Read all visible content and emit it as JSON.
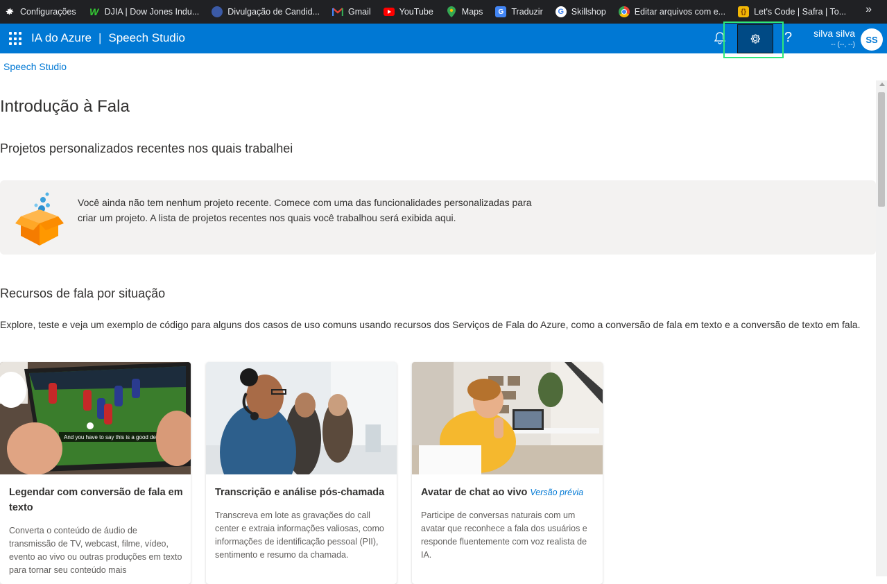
{
  "bookmarks": [
    {
      "label": "Configurações",
      "icon": "gear-icon",
      "color": "#5f6368"
    },
    {
      "label": "DJIA | Dow Jones Indu...",
      "icon": "wsj-icon",
      "color": "#1a8a1a"
    },
    {
      "label": "Divulgação de Candid...",
      "icon": "globe-icon",
      "color": "#3b5aa6"
    },
    {
      "label": "Gmail",
      "icon": "gmail-icon",
      "color": "#ea4335"
    },
    {
      "label": "YouTube",
      "icon": "youtube-icon",
      "color": "#ff0000"
    },
    {
      "label": "Maps",
      "icon": "maps-icon",
      "color": "#34a853"
    },
    {
      "label": "Traduzir",
      "icon": "translate-icon",
      "color": "#4285f4"
    },
    {
      "label": "Skillshop",
      "icon": "google-icon",
      "color": "#ffffff"
    },
    {
      "label": "Editar arquivos com e...",
      "icon": "chrome-icon",
      "color": "#fbbc05"
    },
    {
      "label": "Let's Code | Safra | To...",
      "icon": "letscode-icon",
      "color": "#f2b705"
    }
  ],
  "header": {
    "product": "IA do Azure",
    "separator": "|",
    "app": "Speech Studio",
    "user_name": "silva silva",
    "user_sub": "-- (--, --)",
    "avatar_initials": "SS",
    "help_label": "?"
  },
  "breadcrumb": "Speech Studio",
  "page_title": "Introdução à Fala",
  "recent": {
    "heading": "Projetos personalizados recentes nos quais trabalhei",
    "empty_message": "Você ainda não tem nenhum projeto recente. Comece com uma das funcionalidades personalizadas para criar um projeto. A lista de projetos recentes nos quais você trabalhou será exibida aqui."
  },
  "resources": {
    "heading": "Recursos de fala por situação",
    "description": "Explore, teste e veja um exemplo de código para alguns dos casos de uso comuns usando recursos dos Serviços de Fala do Azure, como a conversão de fala em texto e a conversão de texto em fala."
  },
  "cards": [
    {
      "title": "Legendar com conversão de fala em texto",
      "badge": "",
      "caption": "And you have to say this is a good defense.",
      "description": "Converta o conteúdo de áudio de transmissão de TV, webcast, filme, vídeo, evento ao vivo ou outras produções em texto para tornar seu conteúdo mais"
    },
    {
      "title": "Transcrição e análise pós-chamada",
      "badge": "",
      "description": "Transcreva em lote as gravações do call center e extraia informações valiosas, como informações de identificação pessoal (PII), sentimento e resumo da chamada."
    },
    {
      "title": "Avatar de chat ao vivo",
      "badge": "Versão prévia",
      "description": "Participe de conversas naturais com um avatar que reconhece a fala dos usuários e responde fluentemente com voz realista de IA."
    }
  ],
  "colors": {
    "azure_blue": "#0078d4",
    "highlight": "#2ee87a",
    "bookmarks_bg": "#202124"
  }
}
